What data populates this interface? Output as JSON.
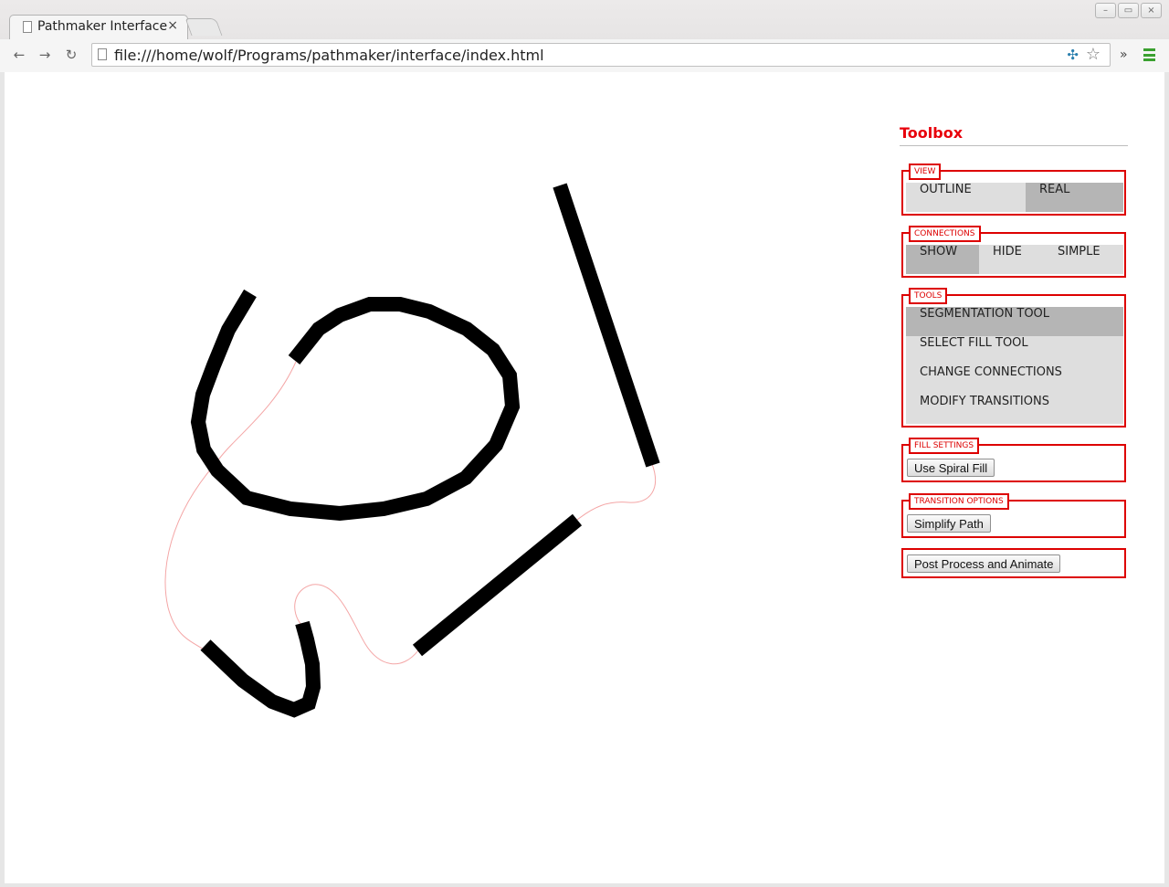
{
  "browser": {
    "tab_title": "Pathmaker Interface",
    "tab_close": "×",
    "url": "file:///home/wolf/Programs/pathmaker/interface/index.html",
    "window_buttons": [
      "–",
      "▭",
      "×"
    ],
    "more_label": "»"
  },
  "toolbox": {
    "title": "Toolbox",
    "view": {
      "legend": "VIEW",
      "options": [
        {
          "label": "OUTLINE",
          "active": false
        },
        {
          "label": "REAL",
          "active": true
        }
      ]
    },
    "connections": {
      "legend": "CONNECTIONS",
      "options": [
        {
          "label": "SHOW",
          "active": true
        },
        {
          "label": "HIDE",
          "active": false
        },
        {
          "label": "SIMPLE",
          "active": false
        }
      ]
    },
    "tools": {
      "legend": "TOOLS",
      "items": [
        {
          "label": "SEGMENTATION TOOL",
          "active": true
        },
        {
          "label": "SELECT FILL TOOL",
          "active": false
        },
        {
          "label": "CHANGE CONNECTIONS",
          "active": false
        },
        {
          "label": "MODIFY TRANSITIONS",
          "active": false
        }
      ]
    },
    "fill_settings": {
      "legend": "FILL SETTINGS",
      "button": "Use Spiral Fill"
    },
    "transition_options": {
      "legend": "TRANSITION OPTIONS",
      "button": "Simplify Path"
    },
    "post_process_button": "Post Process and Animate"
  },
  "colors": {
    "accent": "#dd0000",
    "stroke": "#000000",
    "connection": "#f4a6a6",
    "menu_green": "#3aa02f"
  }
}
